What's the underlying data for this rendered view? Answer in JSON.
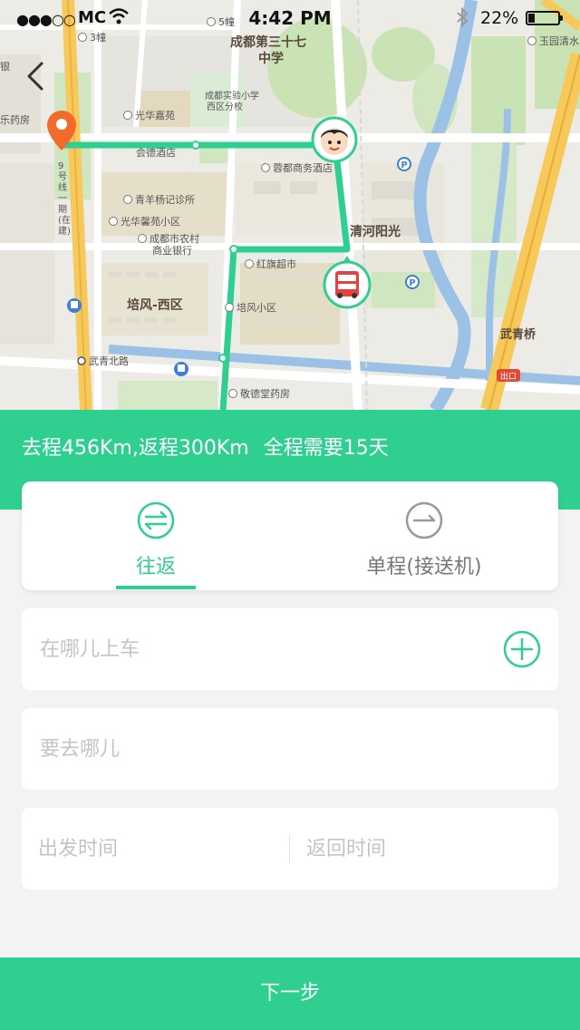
{
  "status_bar": {
    "signal": "●●●○○",
    "carrier": "MC",
    "time": "4:42 PM",
    "battery_text": "22%",
    "battery_level": 0.22
  },
  "map": {
    "labels": {
      "school": "成都第三十七\n中学",
      "school_line1": "成都第三十七",
      "school_line2": "中学",
      "qinghe": "清河阳光",
      "peifeng": "培风-西区",
      "wuqing_bridge": "武青桥",
      "wuqing_road": "武青北路",
      "guanghua_jiayuan": "光华嘉苑",
      "chengdu_shiyan": "成都实验小学",
      "chengdu_shiyan2": "西区分校",
      "rongdu_hotel": "蓉都商务酒店",
      "qingyang_clinic": "青羊杨记诊所",
      "guanghua_xinyuan": "光华馨苑小区",
      "rural_bank1": "成都市农村",
      "rural_bank2": "商业银行",
      "hongqi": "红旗超市",
      "peifeng_xiaoqu": "培风小区",
      "jingde": "敬德堂药房",
      "yuyuan": "玉园清水",
      "building3": "3幢",
      "building5": "5幢",
      "pharmacy": "乐药房",
      "hotel": "会德酒店",
      "exit": "出口",
      "line9": "9号线一期(在建)",
      "jian": "建",
      "yin": "银"
    }
  },
  "trip_info": {
    "outbound": "去程456Km,",
    "return": "返程300Km",
    "duration": "全程需要15天"
  },
  "tabs": {
    "round_trip": "往返",
    "one_way": "单程(接送机)"
  },
  "form": {
    "pickup_placeholder": "在哪儿上车",
    "destination_placeholder": "要去哪儿",
    "depart_placeholder": "出发时间",
    "return_placeholder": "返回时间"
  },
  "next_button": "下一步",
  "colors": {
    "accent": "#2ecf8f",
    "route": "#2ecf8f",
    "pin": "#f26b2a",
    "bus": "#e8413c"
  }
}
